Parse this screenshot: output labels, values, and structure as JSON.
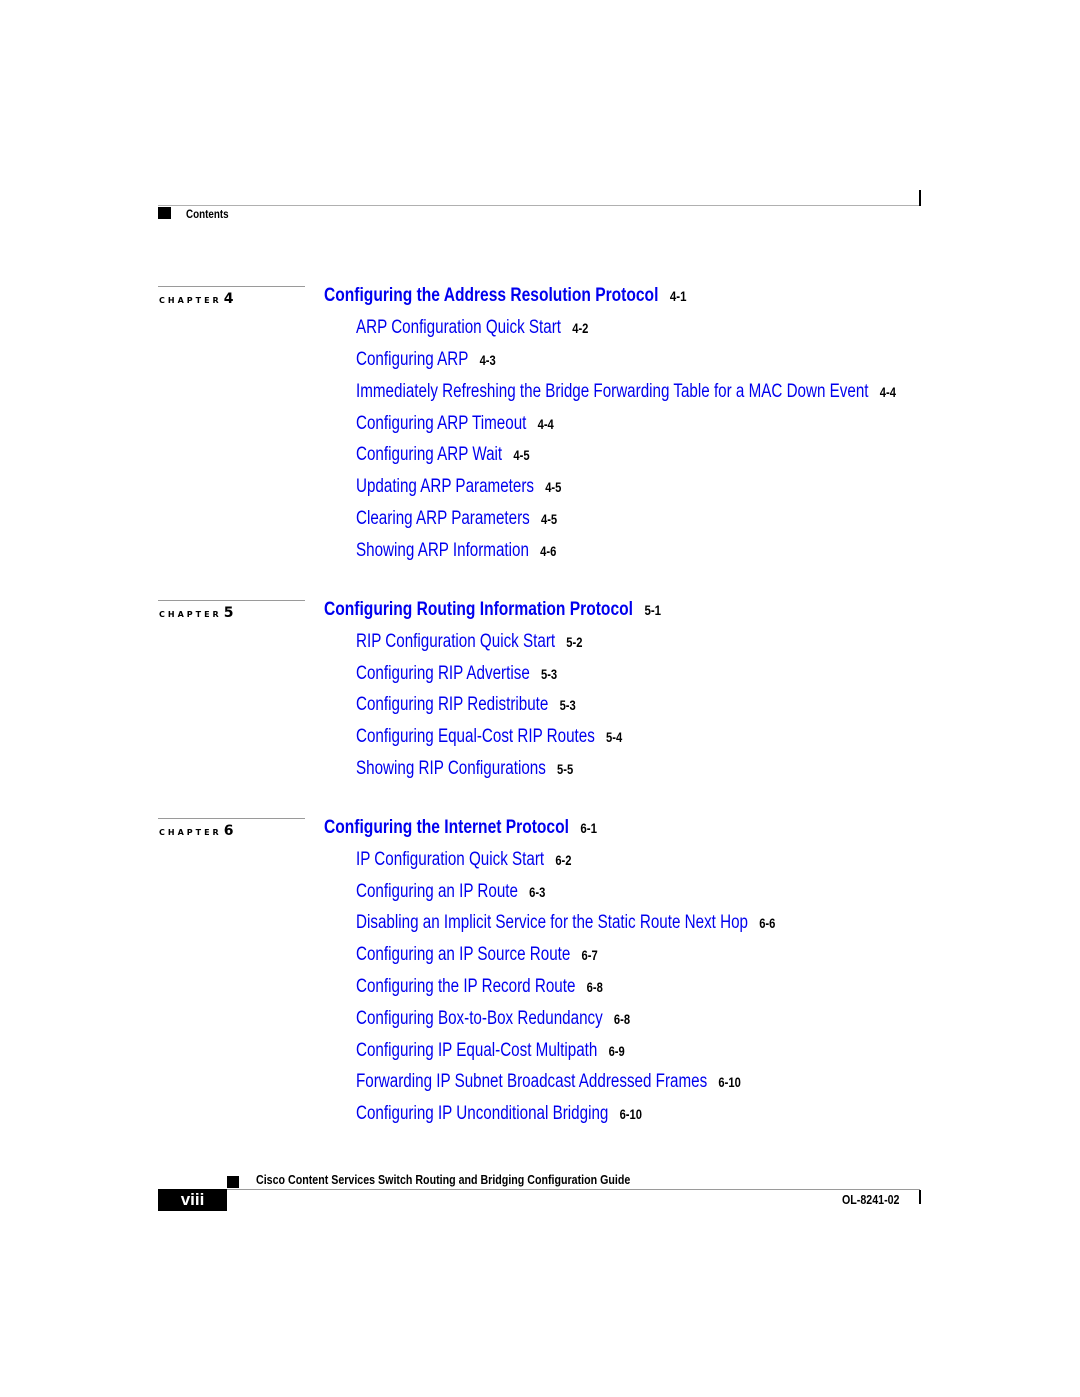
{
  "header": {
    "section_label": "Contents"
  },
  "chapters": [
    {
      "tag": "CHAPTER",
      "number": "4",
      "title": "Configuring the Address Resolution Protocol",
      "page": "4-1",
      "entries": [
        {
          "label": "ARP Configuration Quick Start",
          "page": "4-2"
        },
        {
          "label": "Configuring ARP",
          "page": "4-3"
        },
        {
          "label": "Immediately Refreshing the Bridge Forwarding Table for a MAC Down Event",
          "page": "4-4"
        },
        {
          "label": "Configuring ARP Timeout",
          "page": "4-4"
        },
        {
          "label": "Configuring ARP Wait",
          "page": "4-5"
        },
        {
          "label": "Updating ARP Parameters",
          "page": "4-5"
        },
        {
          "label": "Clearing ARP Parameters",
          "page": "4-5"
        },
        {
          "label": "Showing ARP Information",
          "page": "4-6"
        }
      ]
    },
    {
      "tag": "CHAPTER",
      "number": "5",
      "title": "Configuring Routing Information Protocol",
      "page": "5-1",
      "entries": [
        {
          "label": "RIP Configuration Quick Start",
          "page": "5-2"
        },
        {
          "label": "Configuring RIP Advertise",
          "page": "5-3"
        },
        {
          "label": "Configuring RIP Redistribute",
          "page": "5-3"
        },
        {
          "label": "Configuring Equal-Cost RIP Routes",
          "page": "5-4"
        },
        {
          "label": "Showing RIP Configurations",
          "page": "5-5"
        }
      ]
    },
    {
      "tag": "CHAPTER",
      "number": "6",
      "title": "Configuring the Internet Protocol",
      "page": "6-1",
      "entries": [
        {
          "label": "IP Configuration Quick Start",
          "page": "6-2"
        },
        {
          "label": "Configuring an IP Route",
          "page": "6-3"
        },
        {
          "label": "Disabling an Implicit Service for the Static Route Next Hop",
          "page": "6-6"
        },
        {
          "label": "Configuring an IP Source Route",
          "page": "6-7"
        },
        {
          "label": "Configuring the IP Record Route",
          "page": "6-8"
        },
        {
          "label": "Configuring Box-to-Box Redundancy",
          "page": "6-8"
        },
        {
          "label": "Configuring IP Equal-Cost Multipath",
          "page": "6-9"
        },
        {
          "label": "Forwarding IP Subnet Broadcast Addressed Frames",
          "page": "6-10"
        },
        {
          "label": "Configuring IP Unconditional Bridging",
          "page": "6-10"
        }
      ]
    }
  ],
  "footer": {
    "guide_title": "Cisco Content Services Switch Routing and Bridging Configuration Guide",
    "page_number": "viii",
    "doc_number": "OL-8241-02"
  },
  "colors": {
    "link": "#0000ee",
    "text": "#000000"
  }
}
